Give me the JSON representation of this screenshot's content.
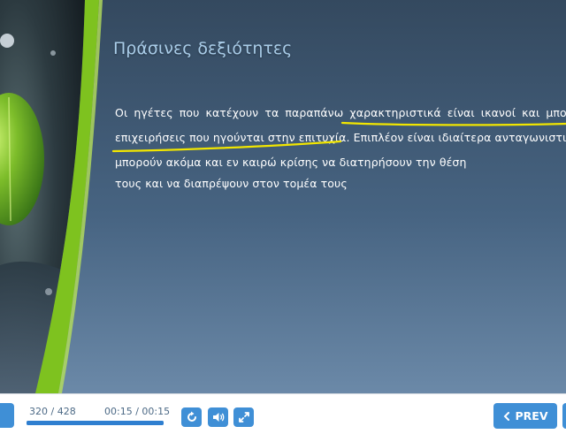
{
  "slide": {
    "title": "Πράσινες δεξιότητες",
    "paragraph": {
      "line1_highlight": "Οι ηγέτες που κατέχουν τα παραπάνω ",
      "line1_underlined": "χαρακτηριστικά είναι ικανοί και μπορο",
      "line2_underlined": "επιχειρήσεις που ηγούνται στην επιτυχία",
      "line2_rest": ". Επιπλέον είναι ιδιαίτερα ανταγωνιστικ",
      "line3": "μπορούν ακόμα και εν καιρώ κρίσης να διατηρήσουν την θέση",
      "line4": "τους και να διαπρέψουν στον τομέα τους"
    },
    "colors": {
      "title": "#a9cce8",
      "underline": "#f2e600",
      "background": "#3d5671",
      "green_band": "#7ec21f"
    }
  },
  "player": {
    "slide_counter": "320 / 428",
    "timer": "00:15 / 00:15",
    "progress": 1.0,
    "prev_label": "PREV",
    "icons": {
      "replay": "replay-icon",
      "volume": "volume-icon",
      "fullscreen": "fullscreen-icon",
      "prev": "chevron-left-icon"
    },
    "accent": "#3f8fd6"
  }
}
